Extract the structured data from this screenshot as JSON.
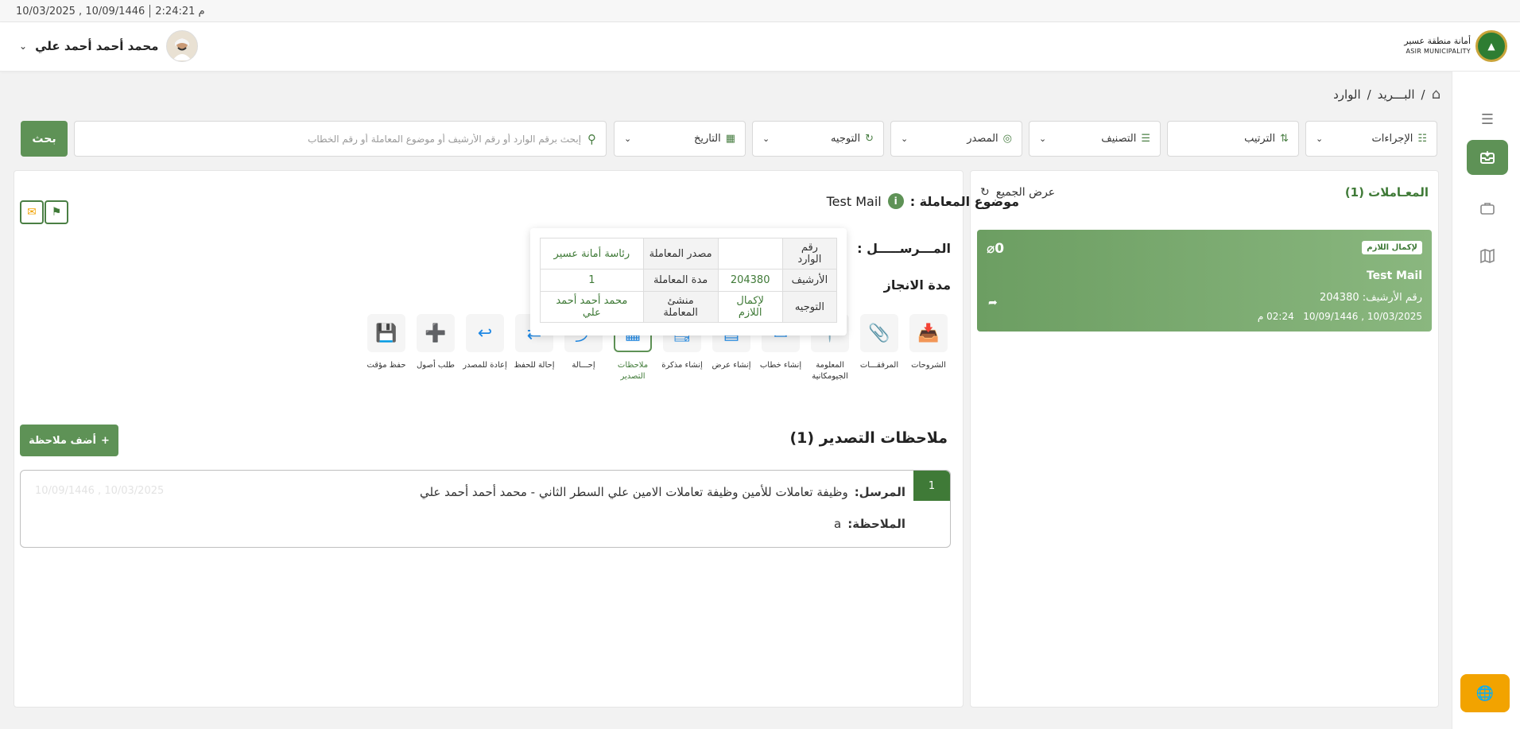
{
  "topbar": {
    "time": "2:24:21 م",
    "dates": "10/03/2025 , 10/09/1446"
  },
  "header": {
    "logo_ar": "أمانة منطقة عسير",
    "logo_en": "ASIR MUNICIPALITY",
    "user_name": "محمد أحمد أحمد علي"
  },
  "breadcrumb": {
    "mail": "البـــريد",
    "inbox": "الوارد",
    "sep": "/"
  },
  "filters": {
    "actions": "الإجراءات",
    "sort": "الترتيب",
    "classification": "التصنيف",
    "source": "المصدر",
    "routing": "التوجيه",
    "date": "التاريخ"
  },
  "search": {
    "placeholder": "إبحث برقم الوارد أو رقم الأرشيف أو موضوع المعاملة أو رقم الخطاب",
    "button": "بحث"
  },
  "list": {
    "count_label": "المعـاملات (1)",
    "show_all": "عرض الجميع",
    "card": {
      "badge": "لإكمال اللازم",
      "attachments": "0",
      "title": "Test Mail",
      "archive": "رقم الأرشيف: 204380",
      "date": "10/03/2025 , 10/09/1446",
      "time": "02:24 م"
    }
  },
  "detail": {
    "subject_label": "موضوع المعاملة :",
    "subject_value": "Test Mail",
    "sender_label": "المـــرســـــل :",
    "duration_label": "مدة الانجاز"
  },
  "popup": {
    "rows": [
      [
        {
          "k": "رقم الوارد",
          "v": ""
        },
        {
          "k": "مصدر المعاملة",
          "v": "رئاسة أمانة عسير"
        }
      ],
      [
        {
          "k": "الأرشيف",
          "v": "204380"
        },
        {
          "k": "مدة المعاملة",
          "v": "1"
        }
      ],
      [
        {
          "k": "التوجيه",
          "v": "لإكمال اللازم"
        },
        {
          "k": "منشئ المعاملة",
          "v": "محمد أحمد أحمد علي"
        }
      ]
    ]
  },
  "actions": [
    {
      "label": "الشروحات",
      "icon": "inbox-icon"
    },
    {
      "label": "المرفقـــات",
      "icon": "paperclip-icon"
    },
    {
      "label": "المعلومة الجيومكانية",
      "icon": "map-pin-icon"
    },
    {
      "label": "إنشاء خطاب",
      "icon": "envelope-icon"
    },
    {
      "label": "إنشاء عرض",
      "icon": "document-icon"
    },
    {
      "label": "إنشاء مذكرة",
      "icon": "memo-icon"
    },
    {
      "label": "ملاحظات التصدير",
      "icon": "notes-icon"
    },
    {
      "label": "إحـــالة",
      "icon": "refer-icon"
    },
    {
      "label": "إحالة للحفظ",
      "icon": "archive-refer-icon"
    },
    {
      "label": "إعادة للمصدر",
      "icon": "return-mail-icon"
    },
    {
      "label": "طلب أصول",
      "icon": "request-add-icon"
    },
    {
      "label": "حفظ مؤقت",
      "icon": "save-icon"
    }
  ],
  "notes": {
    "title": "ملاحظات التصدير (1)",
    "add_button": "أضف ملاحظة",
    "item": {
      "number": "1",
      "sender_label": "المرسل:",
      "sender_value": "وظيفة تعاملات للأمين وظيفة تعاملات الامين علي السطر الثاني - محمد أحمد أحمد علي",
      "note_label": "الملاحظة:",
      "note_value": "a",
      "faded_date": "10/09/1446 , 10/03/2025"
    }
  },
  "colors": {
    "accent": "#5e9256",
    "accent_dark": "#3f7a37",
    "orange": "#f2a300",
    "icon_blue": "#1e88e5"
  }
}
